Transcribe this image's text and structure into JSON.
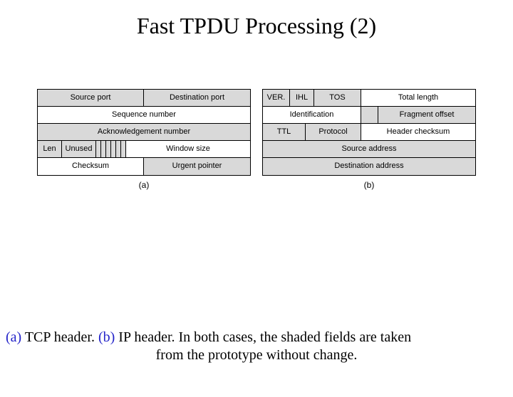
{
  "title": "Fast TPDU Processing (2)",
  "tcp": {
    "source_port": "Source port",
    "dest_port": "Destination  port",
    "seq": "Sequence number",
    "ack": "Acknowledgement number",
    "len": "Len",
    "unused": "Unused",
    "window": "Window size",
    "checksum": "Checksum",
    "urgent": "Urgent pointer",
    "label": "(a)"
  },
  "ip": {
    "ver": "VER.",
    "ihl": "IHL",
    "tos": "TOS",
    "total_length": "Total length",
    "identification": "Identification",
    "frag_offset": "Fragment offset",
    "ttl": "TTL",
    "protocol": "Protocol",
    "checksum": "Header checksum",
    "src_addr": "Source address",
    "dst_addr": "Destination address",
    "label": "(b)"
  },
  "caption": {
    "a": "(a)",
    "a_text": " TCP header.  ",
    "b": "(b)",
    "b_text": " IP header. In both cases, the shaded fields are taken",
    "cont": "from the prototype without change."
  }
}
